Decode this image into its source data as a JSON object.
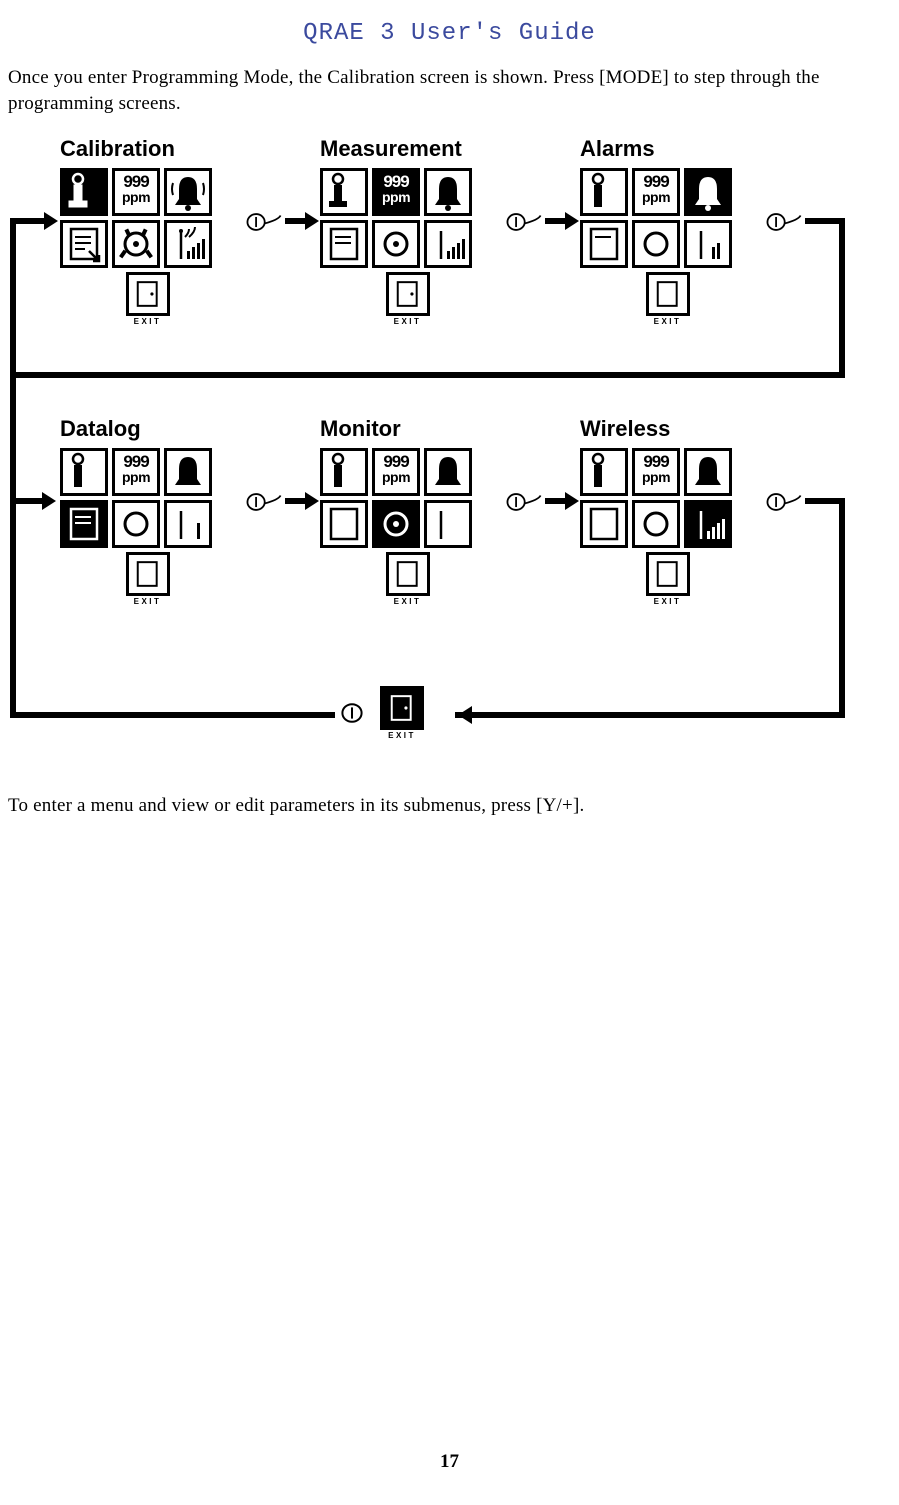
{
  "header": {
    "title": "QRAE 3 User's Guide"
  },
  "intro": "Once you enter Programming Mode, the Calibration screen is shown. Press [MODE] to step through the programming screens.",
  "outro": "To enter a menu and view or edit parameters in its submenus, press [Y/+].",
  "page_number": "17",
  "ppm": {
    "value": "999",
    "unit": "ppm"
  },
  "exit_label": "EXIT",
  "screens": [
    {
      "title": "Calibration",
      "selected": 0
    },
    {
      "title": "Measurement",
      "selected": 1
    },
    {
      "title": "Alarms",
      "selected": 2
    },
    {
      "title": "Datalog",
      "selected": 3
    },
    {
      "title": "Monitor",
      "selected": 4
    },
    {
      "title": "Wireless",
      "selected": 5
    }
  ]
}
